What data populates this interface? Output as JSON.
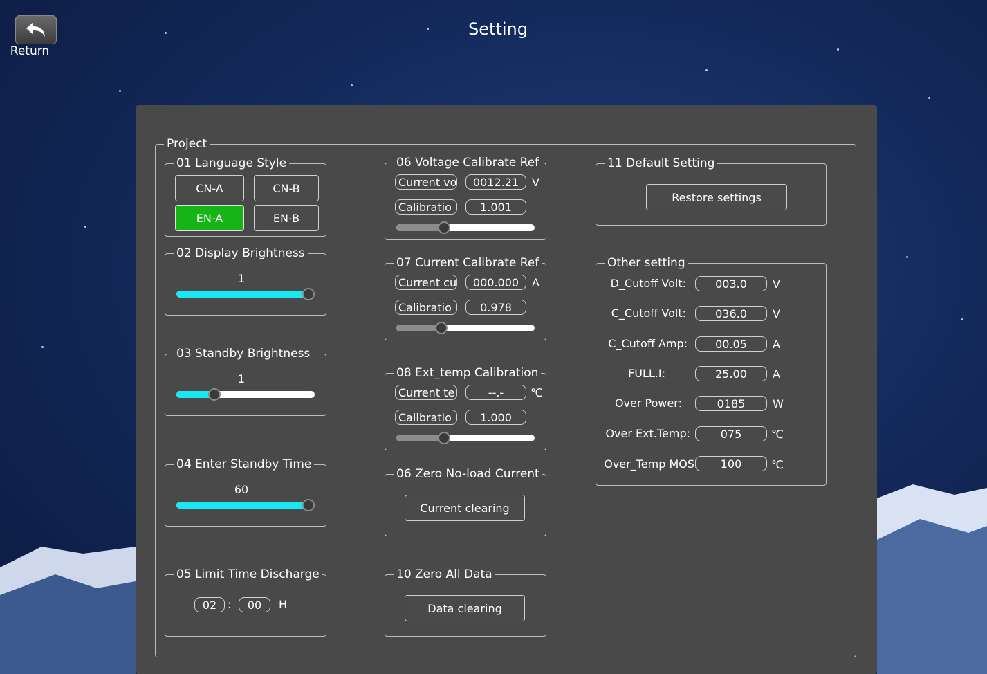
{
  "header": {
    "title": "Setting",
    "return_label": "Return"
  },
  "project": {
    "legend": "Project",
    "language": {
      "legend": "01 Language Style",
      "buttons": [
        "CN-A",
        "CN-B",
        "EN-A",
        "EN-B"
      ],
      "selected": "EN-A"
    },
    "display_brightness": {
      "legend": "02 Display Brightness",
      "value": "1",
      "level": 1.0
    },
    "standby_brightness": {
      "legend": "03 Standby Brightness",
      "value": "1",
      "level": 0.27
    },
    "standby_time": {
      "legend": "04 Enter Standby Time",
      "value": "60",
      "level": 1.0
    },
    "limit_time": {
      "legend": "05 Limit Time Discharge",
      "hours": "02",
      "minutes": "00",
      "separator": ":",
      "unit": "H"
    },
    "voltage_cal": {
      "legend": "06 Voltage Calibrate Ref",
      "current_label": "Current vo",
      "current_value": "0012.21",
      "unit": "V",
      "cal_label": "Calibratio",
      "cal_value": "1.001",
      "level": 0.35
    },
    "current_cal": {
      "legend": "07 Current Calibrate Ref",
      "current_label": "Current cu",
      "current_value": "000.000",
      "unit": "A",
      "cal_label": "Calibratio",
      "cal_value": "0.978",
      "level": 0.33
    },
    "ext_temp_cal": {
      "legend": "08 Ext_temp Calibration",
      "current_label": "Current te",
      "current_value": "--.-",
      "unit": "℃",
      "cal_label": "Calibratio",
      "cal_value": "1.000",
      "level": 0.35
    },
    "zero_noload": {
      "legend": "06 Zero No-load Current",
      "button": "Current clearing"
    },
    "zero_all": {
      "legend": "10 Zero All Data",
      "button": "Data clearing"
    },
    "default_setting": {
      "legend": "11 Default Setting",
      "button": "Restore settings"
    },
    "other": {
      "legend": "Other setting",
      "rows": [
        {
          "label": "D_Cutoff Volt:",
          "value": "003.0",
          "unit": "V"
        },
        {
          "label": "C_Cutoff Volt:",
          "value": "036.0",
          "unit": "V"
        },
        {
          "label": "C_Cutoff Amp:",
          "value": "00.05",
          "unit": "A"
        },
        {
          "label": "FULL.I:",
          "value": "25.00",
          "unit": "A"
        },
        {
          "label": "Over Power:",
          "value": "0185",
          "unit": "W"
        },
        {
          "label": "Over Ext.Temp:",
          "value": "075",
          "unit": "℃"
        },
        {
          "label": "Over_Temp MOS",
          "value": "100",
          "unit": "℃"
        }
      ]
    }
  },
  "colors": {
    "active": "#17b417",
    "slider": "#19e8f0",
    "panel": "#494949"
  }
}
